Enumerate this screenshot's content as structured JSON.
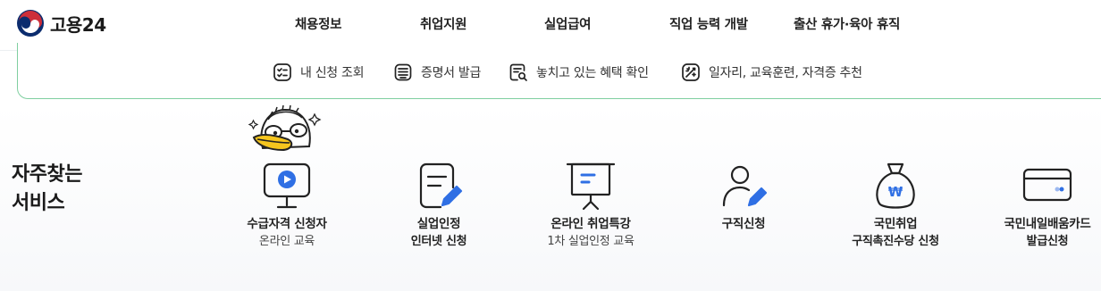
{
  "header": {
    "logo_text": "고용24",
    "nav": [
      "채용정보",
      "취업지원",
      "실업급여",
      "직업 능력 개발",
      "출산 휴가·육아 휴직"
    ]
  },
  "quick_links": [
    {
      "label": "내 신청 조회",
      "icon": "checklist-icon"
    },
    {
      "label": "증명서 발급",
      "icon": "document-icon"
    },
    {
      "label": "놓치고 있는 혜택 확인",
      "icon": "document-search-icon"
    },
    {
      "label": "일자리, 교육훈련, 자격증 추천",
      "icon": "recommend-icon"
    }
  ],
  "services": {
    "title_line1": "자주찾는",
    "title_line2": "서비스",
    "items": [
      {
        "line1": "수급자격 신청자",
        "line2": "온라인 교육",
        "icon": "monitor-play-icon"
      },
      {
        "line1": "실업인정",
        "line2": "인터넷 신청",
        "icon": "document-pen-icon"
      },
      {
        "line1": "온라인 취업특강",
        "line2": "1차 실업인정 교육",
        "icon": "presentation-icon"
      },
      {
        "line1": "구직신청",
        "line2": "",
        "icon": "person-pen-icon"
      },
      {
        "line1": "국민취업",
        "line2": "구직촉진수당 신청",
        "icon": "money-bag-icon"
      },
      {
        "line1": "국민내일배움카드",
        "line2": "발급신청",
        "icon": "card-icon"
      }
    ]
  },
  "colors": {
    "accent_blue": "#2f6fe4",
    "border_green": "#7fcfa0",
    "taegeuk_red": "#cd2e3a",
    "taegeuk_blue": "#0047a0"
  }
}
